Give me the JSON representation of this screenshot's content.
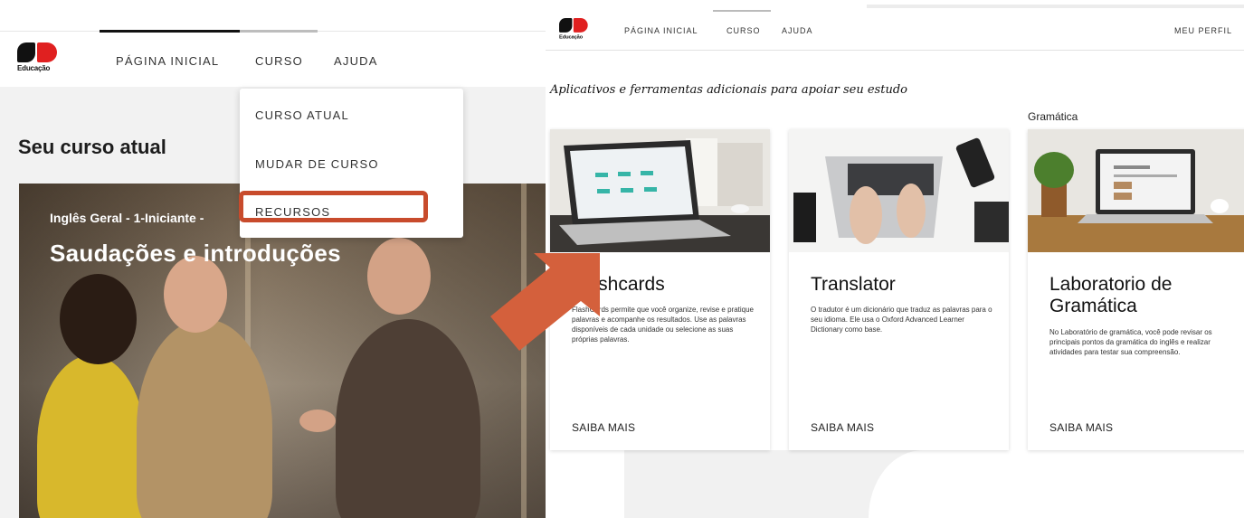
{
  "left": {
    "logo_text": "Educação",
    "nav": [
      "PÁGINA INICIAL",
      "CURSO",
      "AJUDA"
    ],
    "dropdown": [
      "CURSO ATUAL",
      "MUDAR DE CURSO",
      "RECURSOS"
    ],
    "heading": "Seu curso atual",
    "hero_course": "Inglês Geral - 1-Iniciante -",
    "hero_title": "Saudações e introduções"
  },
  "right": {
    "logo_text": "Educação",
    "nav": [
      "PÁGINA INICIAL",
      "CURSO",
      "AJUDA"
    ],
    "profile": "MEU PERFIL",
    "intro": "Aplicativos e ferramentas adicionais para apoiar seu estudo",
    "category": "Gramática",
    "cards": [
      {
        "title": "Flashcards",
        "description": "FlashCards permite que você organize, revise e pratique palavras e acompanhe os resultados. Use as palavras disponíveis de cada unidade ou selecione as suas próprias palavras.",
        "link": "SAIBA MAIS"
      },
      {
        "title": "Translator",
        "description": "O tradutor é um dicionário que traduz as palavras para o seu idioma. Ele usa o Oxford Advanced Learner Dictionary como base.",
        "link": "SAIBA MAIS"
      },
      {
        "title": "Laboratorio de Gramática",
        "description": "No Laboratório de gramática, você pode revisar os principais pontos da gramática do inglês e realizar atividades para testar sua compreensão.",
        "link": "SAIBA MAIS"
      }
    ]
  },
  "colors": {
    "highlight": "#c84b2c",
    "arrow": "#d4603c",
    "brand_red": "#e02020"
  }
}
